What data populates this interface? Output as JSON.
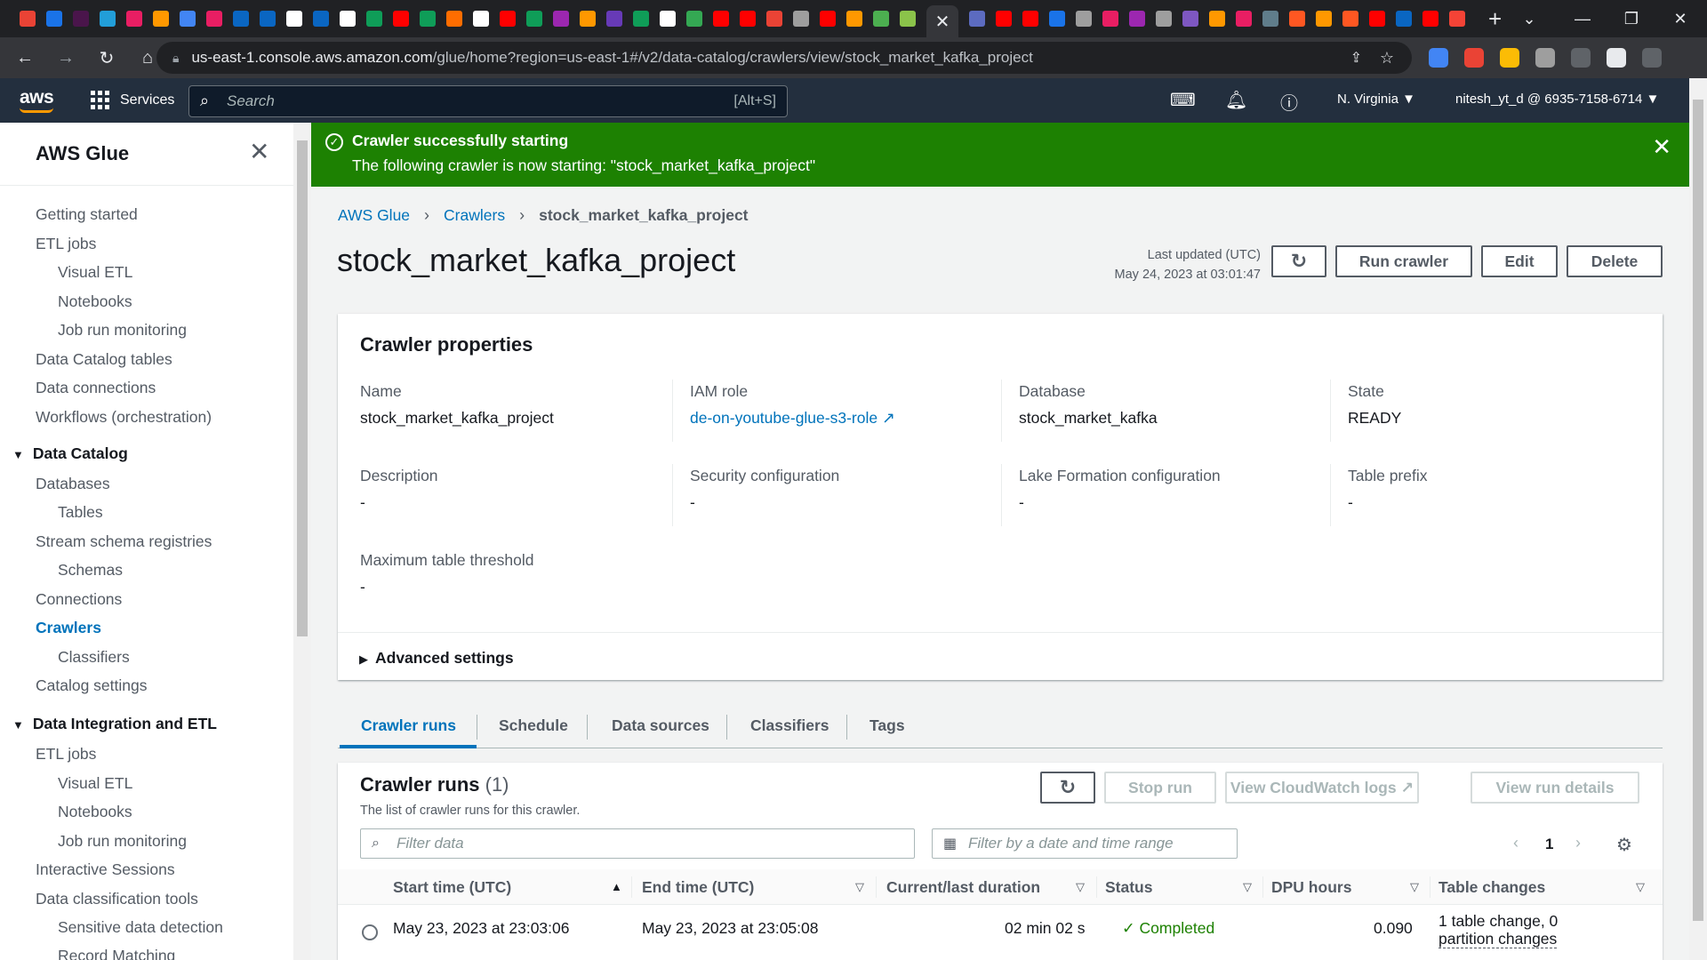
{
  "browser": {
    "url_host": "us-east-1.console.aws.amazon.com",
    "url_path": "/glue/home?region=us-east-1#/v2/data-catalog/crawlers/view/stock_market_kafka_project",
    "tab_colors": [
      "#ea4335",
      "#1a73e8",
      "#4a154b",
      "#229ed9",
      "#e91e63",
      "#ff9800",
      "#4285f4",
      "#e91e63",
      "#0a66c2",
      "#0a66c2",
      "#ffffff",
      "#0a66c2",
      "#ffffff",
      "#0f9d58",
      "#ff0000",
      "#0f9d58",
      "#ff6d00",
      "#ffffff",
      "#ff0000",
      "#0f9d58",
      "#9c27b0",
      "#ff9800",
      "#673ab7",
      "#0f9d58",
      "#ffffff",
      "#34a853",
      "#ff0000",
      "#ff0000",
      "#ea4335",
      "#9e9e9e",
      "#ff0000",
      "#ff9800",
      "#4caf50",
      "#8bc34a"
    ],
    "tab_colors_right": [
      "#5c6bc0",
      "#ff0000",
      "#ff0000",
      "#1a73e8",
      "#9e9e9e",
      "#e91e63",
      "#9c27b0",
      "#9e9e9e",
      "#7e57c2",
      "#ff9800",
      "#e91e63",
      "#607d8b",
      "#ff5722",
      "#ff9800",
      "#ff5722",
      "#ff0000",
      "#0a66c2",
      "#ff0000",
      "#f44336"
    ],
    "ext_colors": [
      "#4285f4",
      "#ea4335",
      "#fbbc05",
      "#9e9e9e",
      "#5f6368",
      "#e8eaed",
      "#5f6368"
    ]
  },
  "aws_nav": {
    "logo": "aws",
    "services": "Services",
    "search_placeholder": "Search",
    "search_shortcut": "[Alt+S]",
    "region": "N. Virginia ▼",
    "account": "nitesh_yt_d @ 6935-7158-6714 ▼"
  },
  "sidebar": {
    "title": "AWS Glue",
    "items_top": [
      "Getting started",
      "ETL jobs"
    ],
    "etl_sub": [
      "Visual ETL",
      "Notebooks",
      "Job run monitoring"
    ],
    "items_mid": [
      "Data Catalog tables",
      "Data connections",
      "Workflows (orchestration)"
    ],
    "sec_catalog": "Data Catalog",
    "databases": "Databases",
    "tables": "Tables",
    "stream": "Stream schema registries",
    "schemas": "Schemas",
    "connections": "Connections",
    "crawlers": "Crawlers",
    "classifiers": "Classifiers",
    "catalog_settings": "Catalog settings",
    "sec_integration": "Data Integration and ETL",
    "etl_jobs": "ETL jobs",
    "visual_etl": "Visual ETL",
    "notebooks": "Notebooks",
    "job_run_monitoring": "Job run monitoring",
    "interactive": "Interactive Sessions",
    "classification": "Data classification tools",
    "sensitive": "Sensitive data detection",
    "record_matching": "Record Matching"
  },
  "flash": {
    "heading": "Crawler successfully starting",
    "message": "The following crawler is now starting: \"stock_market_kafka_project\""
  },
  "breadcrumb": [
    "AWS Glue",
    "Crawlers",
    "stock_market_kafka_project"
  ],
  "page_title": "stock_market_kafka_project",
  "last_updated_label": "Last updated (UTC)",
  "last_updated_value": "May 24, 2023 at 03:01:47",
  "buttons": {
    "run": "Run crawler",
    "edit": "Edit",
    "delete": "Delete"
  },
  "properties": {
    "heading": "Crawler properties",
    "name_k": "Name",
    "name_v": "stock_market_kafka_project",
    "iam_k": "IAM role",
    "iam_v": "de-on-youtube-glue-s3-role",
    "db_k": "Database",
    "db_v": "stock_market_kafka",
    "state_k": "State",
    "state_v": "READY",
    "desc_k": "Description",
    "desc_v": "-",
    "sec_k": "Security configuration",
    "sec_v": "-",
    "lake_k": "Lake Formation configuration",
    "lake_v": "-",
    "prefix_k": "Table prefix",
    "prefix_v": "-",
    "max_k": "Maximum table threshold",
    "max_v": "-",
    "advanced": "Advanced settings"
  },
  "tabs": [
    "Crawler runs",
    "Schedule",
    "Data sources",
    "Classifiers",
    "Tags"
  ],
  "runs": {
    "title": "Crawler runs",
    "count": "(1)",
    "desc": "The list of crawler runs for this crawler.",
    "stop": "Stop run",
    "cloudwatch": "View CloudWatch logs",
    "details": "View run details",
    "filter_placeholder": "Filter data",
    "date_placeholder": "Filter by a date and time range",
    "page": "1",
    "columns": [
      "Start time (UTC)",
      "End time (UTC)",
      "Current/last duration",
      "Status",
      "DPU hours",
      "Table changes"
    ],
    "row": {
      "start": "May 23, 2023 at 23:03:06",
      "end": "May 23, 2023 at 23:05:08",
      "duration": "02 min 02 s",
      "status": "Completed",
      "dpu": "0.090",
      "changes_1": "1 table change, 0",
      "changes_2": "partition changes"
    }
  }
}
